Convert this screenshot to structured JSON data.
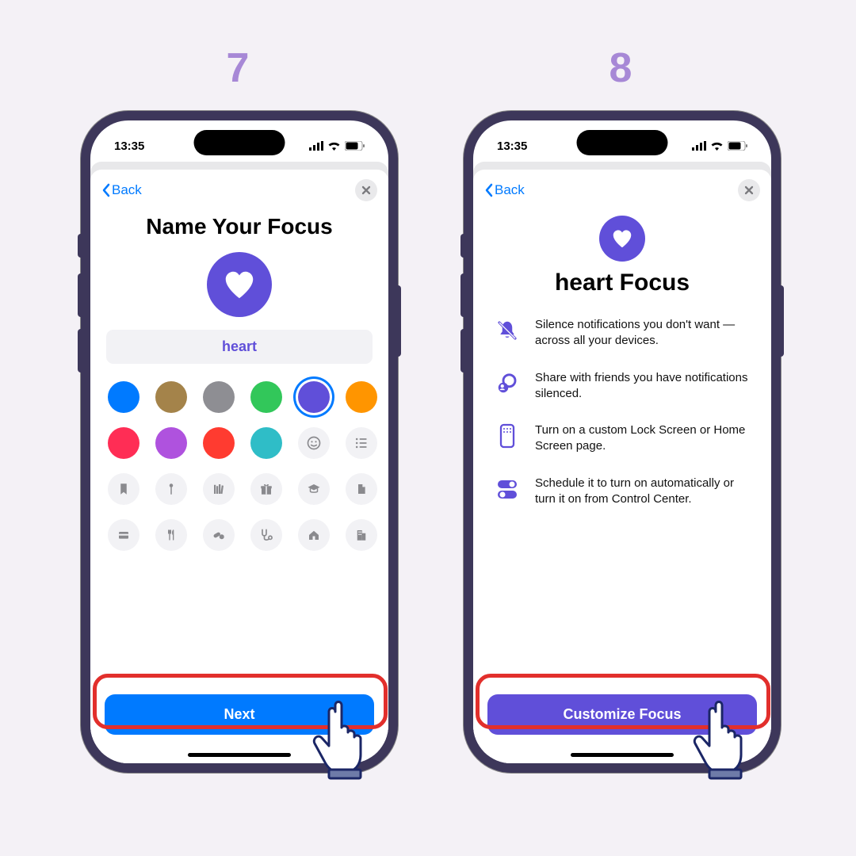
{
  "steps": {
    "left": "7",
    "right": "8"
  },
  "status": {
    "time": "13:35"
  },
  "back_label": "Back",
  "screen7": {
    "title": "Name Your Focus",
    "name_value": "heart",
    "colors": [
      "#007aff",
      "#a4834a",
      "#8e8e93",
      "#32c75a",
      "#604fd9",
      "#ff9500",
      "#ff2d55",
      "#af52de",
      "#ff3b30",
      "#2fbdc7"
    ],
    "selected_color_index": 4,
    "next_btn": "Next"
  },
  "screen8": {
    "title": "heart Focus",
    "features": [
      "Silence notifications you don't want — across all your devices.",
      "Share with friends you have notifications silenced.",
      "Turn on a custom Lock Screen or Home Screen page.",
      "Schedule it to turn on automatically or turn it on from Control Center."
    ],
    "customize_btn": "Customize Focus"
  },
  "colors_ui": {
    "accent_purple": "#604fd9",
    "ios_blue": "#007aff",
    "callout_red": "#e22f2c"
  }
}
